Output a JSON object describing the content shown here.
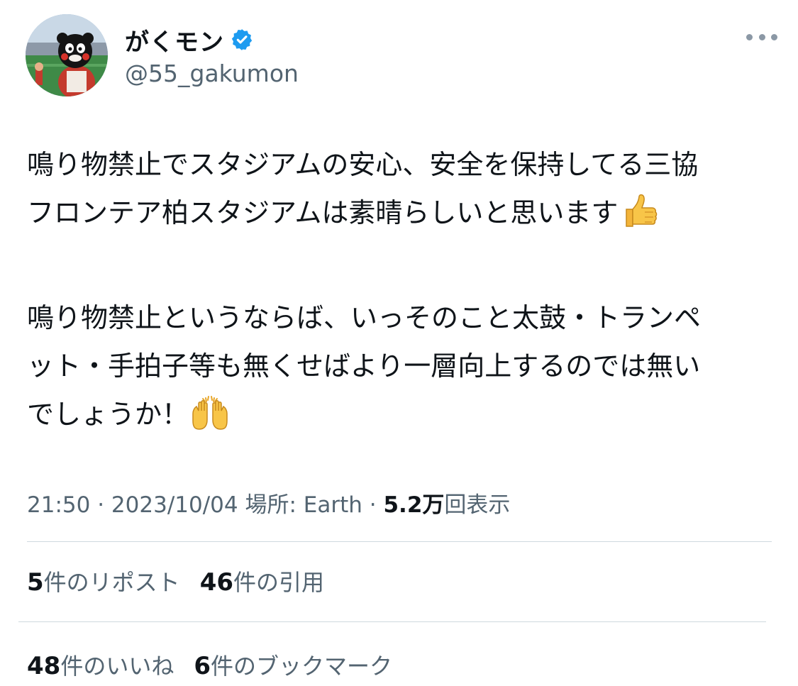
{
  "author": {
    "display_name": "がくモン",
    "handle": "@55_gakumon",
    "verified": true
  },
  "tweet": {
    "lines": [
      "鳴り物禁止でスタジアムの安心、安全を保持してる三協",
      "フロンテア柏スタジアムは素晴らしいと思います",
      "鳴り物禁止というならば、いっそのこと太鼓・トランペ",
      "ット・手拍子等も無くせばより一層向上するのでは無い",
      "でしょうか！"
    ],
    "emojis": [
      "thumbs-up-emoji",
      "raising-hands-emoji"
    ]
  },
  "meta": {
    "time": "21:50",
    "separator": "·",
    "date": "2023/10/04",
    "location_label": "場所: Earth",
    "views_number": "5.2万",
    "views_label": "回表示"
  },
  "stats": {
    "reposts_count": "5",
    "reposts_label": "件のリポスト",
    "quotes_count": "46",
    "quotes_label": "件の引用",
    "likes_count": "48",
    "likes_label": "件のいいね",
    "bookmarks_count": "6",
    "bookmarks_label": "件のブックマーク"
  },
  "colors": {
    "text_primary": "#0f1419",
    "text_secondary": "#536471",
    "verified_blue": "#1d9bf0",
    "divider": "#cfd9de"
  }
}
